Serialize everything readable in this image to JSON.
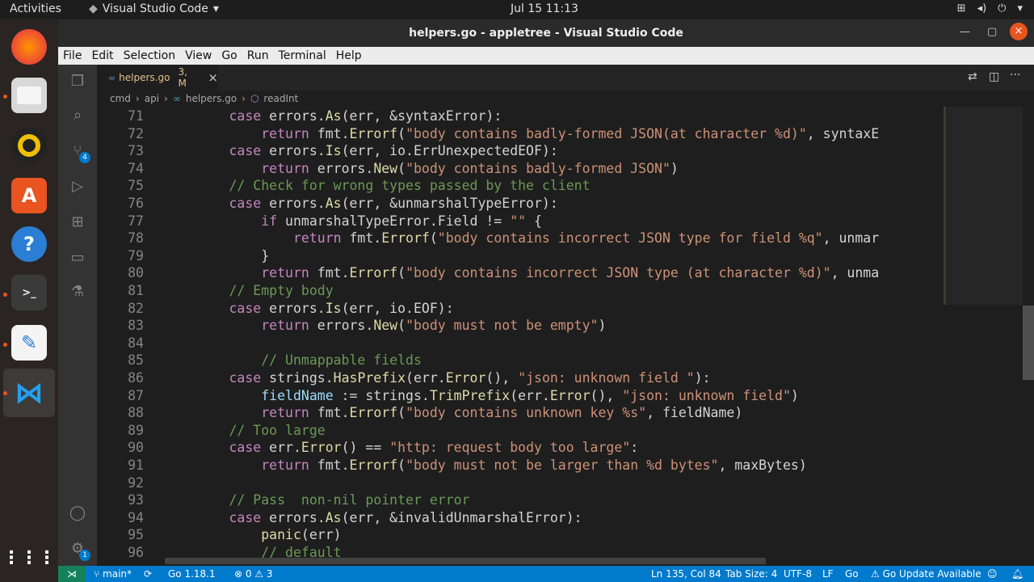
{
  "topbar": {
    "activities": "Activities",
    "app_name": "Visual Studio Code",
    "clock": "Jul 15  11:13"
  },
  "window": {
    "title": "helpers.go - appletree - Visual Studio Code"
  },
  "menu": [
    "File",
    "Edit",
    "Selection",
    "View",
    "Go",
    "Run",
    "Terminal",
    "Help"
  ],
  "tab": {
    "filename": "helpers.go",
    "badge": "3, M",
    "close": "×"
  },
  "breadcrumb": {
    "p1": "cmd",
    "p2": "api",
    "p3": "helpers.go",
    "p4": "readInt"
  },
  "status": {
    "branch": "main*",
    "go_version": "Go 1.18.1",
    "errors": "0",
    "warnings": "3",
    "position": "Ln 135, Col 84",
    "tab_size": "Tab Size: 4",
    "encoding": "UTF-8",
    "eol": "LF",
    "lang": "Go",
    "update": "Go Update Available"
  },
  "scm_badge": "4",
  "accounts_badge": "1",
  "code_lines": [
    {
      "n": "71",
      "t": [
        [
          "",
          "        "
        ],
        [
          "kw",
          "case "
        ],
        [
          "pk",
          "errors."
        ],
        [
          "fn",
          "As"
        ],
        [
          "pk",
          "(err, &syntaxError):"
        ]
      ]
    },
    {
      "n": "72",
      "t": [
        [
          "",
          "            "
        ],
        [
          "kw",
          "return "
        ],
        [
          "pk",
          "fmt."
        ],
        [
          "fn",
          "Errorf"
        ],
        [
          "pk",
          "("
        ],
        [
          "str",
          "\"body contains badly-formed JSON(at character %d)\""
        ],
        [
          "pk",
          ", syntaxE"
        ]
      ]
    },
    {
      "n": "73",
      "t": [
        [
          "",
          "        "
        ],
        [
          "kw",
          "case "
        ],
        [
          "pk",
          "errors."
        ],
        [
          "fn",
          "Is"
        ],
        [
          "pk",
          "(err, io.ErrUnexpectedEOF):"
        ]
      ]
    },
    {
      "n": "74",
      "t": [
        [
          "",
          "            "
        ],
        [
          "kw",
          "return "
        ],
        [
          "pk",
          "errors."
        ],
        [
          "fn",
          "New"
        ],
        [
          "pk",
          "("
        ],
        [
          "str",
          "\"body contains badly-formed JSON\""
        ],
        [
          "pk",
          ")"
        ]
      ]
    },
    {
      "n": "75",
      "t": [
        [
          "",
          "        "
        ],
        [
          "cmt",
          "// Check for wrong types passed by the client"
        ]
      ]
    },
    {
      "n": "76",
      "t": [
        [
          "",
          "        "
        ],
        [
          "kw",
          "case "
        ],
        [
          "pk",
          "errors."
        ],
        [
          "fn",
          "As"
        ],
        [
          "pk",
          "(err, &unmarshalTypeError):"
        ]
      ]
    },
    {
      "n": "77",
      "t": [
        [
          "",
          "            "
        ],
        [
          "kw",
          "if "
        ],
        [
          "pk",
          "unmarshalTypeError.Field != "
        ],
        [
          "str",
          "\"\""
        ],
        [
          "pk",
          " {"
        ]
      ]
    },
    {
      "n": "78",
      "t": [
        [
          "",
          "                "
        ],
        [
          "kw",
          "return "
        ],
        [
          "pk",
          "fmt."
        ],
        [
          "fn",
          "Errorf"
        ],
        [
          "pk",
          "("
        ],
        [
          "str",
          "\"body contains incorrect JSON type for field %q\""
        ],
        [
          "pk",
          ", unmar"
        ]
      ]
    },
    {
      "n": "79",
      "t": [
        [
          "",
          "            "
        ],
        [
          "pk",
          "}"
        ]
      ]
    },
    {
      "n": "80",
      "t": [
        [
          "",
          "            "
        ],
        [
          "kw",
          "return "
        ],
        [
          "pk",
          "fmt."
        ],
        [
          "fn",
          "Errorf"
        ],
        [
          "pk",
          "("
        ],
        [
          "str",
          "\"body contains incorrect JSON type (at character %d)\""
        ],
        [
          "pk",
          ", unma"
        ]
      ]
    },
    {
      "n": "81",
      "t": [
        [
          "",
          "        "
        ],
        [
          "cmt",
          "// Empty body"
        ]
      ]
    },
    {
      "n": "82",
      "t": [
        [
          "",
          "        "
        ],
        [
          "kw",
          "case "
        ],
        [
          "pk",
          "errors."
        ],
        [
          "fn",
          "Is"
        ],
        [
          "pk",
          "(err, io.EOF):"
        ]
      ]
    },
    {
      "n": "83",
      "t": [
        [
          "",
          "            "
        ],
        [
          "kw",
          "return "
        ],
        [
          "pk",
          "errors."
        ],
        [
          "fn",
          "New"
        ],
        [
          "pk",
          "("
        ],
        [
          "str",
          "\"body must not be empty\""
        ],
        [
          "pk",
          ")"
        ]
      ]
    },
    {
      "n": "84",
      "t": [
        [
          "",
          ""
        ]
      ]
    },
    {
      "n": "85",
      "t": [
        [
          "",
          "            "
        ],
        [
          "cmt",
          "// Unmappable fields"
        ]
      ]
    },
    {
      "n": "86",
      "t": [
        [
          "",
          "        "
        ],
        [
          "kw",
          "case "
        ],
        [
          "pk",
          "strings."
        ],
        [
          "fn",
          "HasPrefix"
        ],
        [
          "pk",
          "(err."
        ],
        [
          "fn",
          "Error"
        ],
        [
          "pk",
          "(), "
        ],
        [
          "str",
          "\"json: unknown field \""
        ],
        [
          "pk",
          "):"
        ]
      ]
    },
    {
      "n": "87",
      "t": [
        [
          "",
          "            "
        ],
        [
          "var",
          "fieldName"
        ],
        [
          "pk",
          " := strings."
        ],
        [
          "fn",
          "TrimPrefix"
        ],
        [
          "pk",
          "(err."
        ],
        [
          "fn",
          "Error"
        ],
        [
          "pk",
          "(), "
        ],
        [
          "str",
          "\"json: unknown field\""
        ],
        [
          "pk",
          ")"
        ]
      ]
    },
    {
      "n": "88",
      "t": [
        [
          "",
          "            "
        ],
        [
          "kw",
          "return "
        ],
        [
          "pk",
          "fmt."
        ],
        [
          "fn",
          "Errorf"
        ],
        [
          "pk",
          "("
        ],
        [
          "str",
          "\"body contains unknown key %s\""
        ],
        [
          "pk",
          ", fieldName)"
        ]
      ]
    },
    {
      "n": "89",
      "t": [
        [
          "",
          "        "
        ],
        [
          "cmt",
          "// Too large"
        ]
      ]
    },
    {
      "n": "90",
      "t": [
        [
          "",
          "        "
        ],
        [
          "kw",
          "case "
        ],
        [
          "pk",
          "err."
        ],
        [
          "fn",
          "Error"
        ],
        [
          "pk",
          "() == "
        ],
        [
          "str",
          "\"http: request body too large\""
        ],
        [
          "pk",
          ":"
        ]
      ]
    },
    {
      "n": "91",
      "t": [
        [
          "",
          "            "
        ],
        [
          "kw",
          "return "
        ],
        [
          "pk",
          "fmt."
        ],
        [
          "fn",
          "Errorf"
        ],
        [
          "pk",
          "("
        ],
        [
          "str",
          "\"body must not be larger than %d bytes\""
        ],
        [
          "pk",
          ", maxBytes)"
        ]
      ]
    },
    {
      "n": "92",
      "t": [
        [
          "",
          ""
        ]
      ]
    },
    {
      "n": "93",
      "t": [
        [
          "",
          "        "
        ],
        [
          "cmt",
          "// Pass  non-nil pointer error"
        ]
      ]
    },
    {
      "n": "94",
      "t": [
        [
          "",
          "        "
        ],
        [
          "kw",
          "case "
        ],
        [
          "pk",
          "errors."
        ],
        [
          "fn",
          "As"
        ],
        [
          "pk",
          "(err, &invalidUnmarshalError):"
        ]
      ]
    },
    {
      "n": "95",
      "t": [
        [
          "",
          "            "
        ],
        [
          "fn",
          "panic"
        ],
        [
          "pk",
          "(err)"
        ]
      ]
    },
    {
      "n": "96",
      "t": [
        [
          "",
          "            "
        ],
        [
          "cmt",
          "// default"
        ]
      ]
    }
  ]
}
